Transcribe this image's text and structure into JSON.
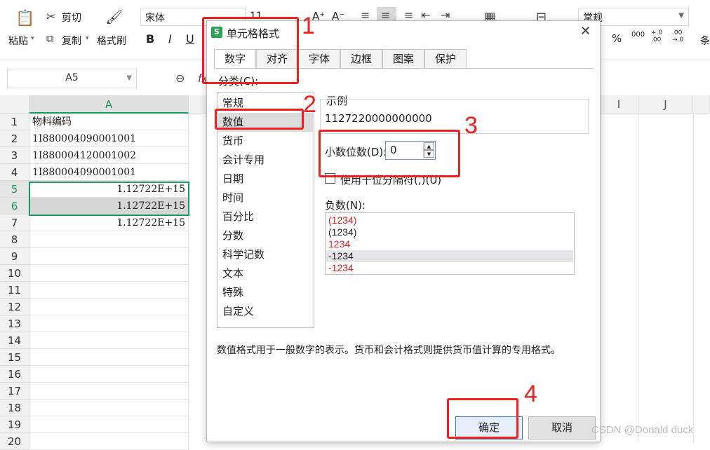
{
  "ribbon": {
    "cut_label": "剪切",
    "paste_label": "粘贴",
    "copy_label": "复制",
    "format_painter_label": "格式刷",
    "font_name": "宋体",
    "font_size": "11",
    "number_format": "常规",
    "bold": "B",
    "italic": "I",
    "underline": "U",
    "percent": "%",
    "thousands": "000",
    "dec_increase": "+.0\n.00",
    "dec_decrease": ".00\n→.0",
    "condition_label": "条"
  },
  "formula_bar": {
    "name_box": "A5",
    "fx": "fx"
  },
  "sheet": {
    "columns": [
      "A",
      "I",
      "J"
    ],
    "rows": [
      {
        "num": "1",
        "a": "物料编码",
        "num_align": false
      },
      {
        "num": "2",
        "a": "1I880004090001001",
        "num_align": false
      },
      {
        "num": "3",
        "a": "1I880004120001002",
        "num_align": false
      },
      {
        "num": "4",
        "a": "1I880004090001001",
        "num_align": false
      },
      {
        "num": "5",
        "a": "1.12722E+15",
        "num_align": true
      },
      {
        "num": "6",
        "a": "1.12722E+15",
        "num_align": true
      },
      {
        "num": "7",
        "a": "1.12722E+15",
        "num_align": true
      },
      {
        "num": "8",
        "a": ""
      },
      {
        "num": "9",
        "a": ""
      },
      {
        "num": "10",
        "a": ""
      },
      {
        "num": "11",
        "a": ""
      },
      {
        "num": "12",
        "a": ""
      },
      {
        "num": "13",
        "a": ""
      },
      {
        "num": "14",
        "a": ""
      },
      {
        "num": "15",
        "a": ""
      },
      {
        "num": "16",
        "a": ""
      },
      {
        "num": "17",
        "a": ""
      },
      {
        "num": "18",
        "a": ""
      },
      {
        "num": "19",
        "a": ""
      },
      {
        "num": "20",
        "a": ""
      }
    ]
  },
  "dialog": {
    "title": "单元格格式",
    "logo": "S",
    "close": "✕",
    "tabs": [
      "数字",
      "对齐",
      "字体",
      "边框",
      "图案",
      "保护"
    ],
    "category_label": "分类(C):",
    "categories": [
      "常规",
      "数值",
      "货币",
      "会计专用",
      "日期",
      "时间",
      "百分比",
      "分数",
      "科学记数",
      "文本",
      "特殊",
      "自定义"
    ],
    "selected_category": "数值",
    "sample_label": "示例",
    "sample_value": "1127220000000000",
    "decimal_label": "小数位数(D):",
    "decimal_value": "0",
    "thousand_sep_label": "使用千位分隔符(,)(U)",
    "negative_label": "负数(N):",
    "negative_options": [
      {
        "text": "(1234)",
        "color": "#e02020"
      },
      {
        "text": "(1234)",
        "color": "#222222"
      },
      {
        "text": "1234",
        "color": "#e02020"
      },
      {
        "text": "-1234",
        "color": "#222222"
      },
      {
        "text": "-1234",
        "color": "#e02020"
      }
    ],
    "description": "数值格式用于一般数字的表示。货币和会计格式则提供货币值计算的专用格式。",
    "ok_label": "确定",
    "cancel_label": "取消"
  },
  "annotations": [
    "1",
    "2",
    "3",
    "4"
  ],
  "watermark": "CSDN @Donald duck",
  "colors": {
    "accent_green": "#1a9a5a",
    "annotation_red": "#ee2020"
  }
}
